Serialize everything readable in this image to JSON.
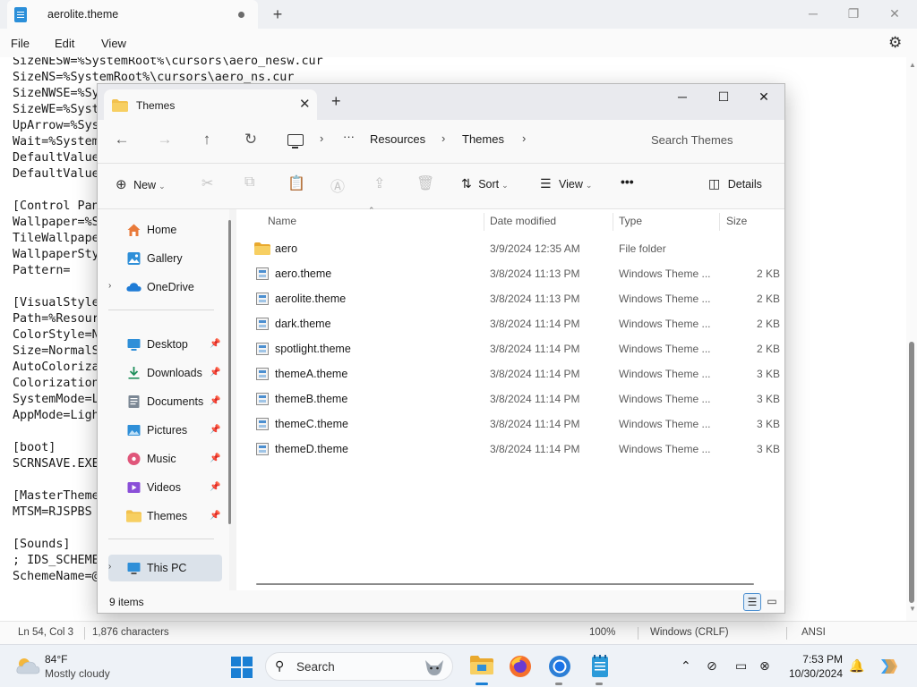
{
  "notepad": {
    "tab_title": "aerolite.theme",
    "menu": [
      "File",
      "Edit",
      "View"
    ],
    "lines": [
      "SizeNESW=%SystemRoot%\\cursors\\aero_nesw.cur",
      "SizeNS=%SystemRoot%\\cursors\\aero_ns.cur",
      "SizeNWSE=%Sy",
      "SizeWE=%Syst",
      "UpArrow=%Sys",
      "Wait=%System",
      "DefaultValue",
      "DefaultValue",
      "",
      "[Control Pan",
      "Wallpaper=%S",
      "TileWallpape",
      "WallpaperSty",
      "Pattern=",
      "",
      "[VisualStyle",
      "Path=%Resour",
      "ColorStyle=N",
      "Size=NormalS",
      "AutoColoriza",
      "Colorization",
      "SystemMode=L",
      "AppMode=Ligh",
      "",
      "[boot]",
      "SCRNSAVE.EXE",
      "",
      "[MasterTheme",
      "MTSM=RJSPBS",
      "",
      "[Sounds]",
      "; IDS_SCHEME",
      "SchemeName=@"
    ],
    "status": {
      "position": "Ln 54, Col 3",
      "characters": "1,876 characters",
      "zoom": "100%",
      "line_endings": "Windows (CRLF)",
      "encoding": "ANSI"
    }
  },
  "explorer": {
    "tab_title": "Themes",
    "breadcrumb": [
      "Resources",
      "Themes"
    ],
    "search_placeholder": "Search Themes",
    "toolbar": {
      "new": "New",
      "sort": "Sort",
      "view": "View",
      "more": "•••",
      "details": "Details"
    },
    "nav": {
      "home": "Home",
      "gallery": "Gallery",
      "onedrive": "OneDrive",
      "desktop": "Desktop",
      "downloads": "Downloads",
      "documents": "Documents",
      "pictures": "Pictures",
      "music": "Music",
      "videos": "Videos",
      "themes": "Themes",
      "thispc": "This PC"
    },
    "columns": [
      "Name",
      "Date modified",
      "Type",
      "Size"
    ],
    "files": [
      {
        "name": "aero",
        "date": "3/9/2024 12:35 AM",
        "type": "File folder",
        "size": "",
        "is_folder": true
      },
      {
        "name": "aero.theme",
        "date": "3/8/2024 11:13 PM",
        "type": "Windows Theme ...",
        "size": "2 KB"
      },
      {
        "name": "aerolite.theme",
        "date": "3/8/2024 11:13 PM",
        "type": "Windows Theme ...",
        "size": "2 KB"
      },
      {
        "name": "dark.theme",
        "date": "3/8/2024 11:14 PM",
        "type": "Windows Theme ...",
        "size": "2 KB"
      },
      {
        "name": "spotlight.theme",
        "date": "3/8/2024 11:14 PM",
        "type": "Windows Theme ...",
        "size": "2 KB"
      },
      {
        "name": "themeA.theme",
        "date": "3/8/2024 11:14 PM",
        "type": "Windows Theme ...",
        "size": "3 KB"
      },
      {
        "name": "themeB.theme",
        "date": "3/8/2024 11:14 PM",
        "type": "Windows Theme ...",
        "size": "3 KB"
      },
      {
        "name": "themeC.theme",
        "date": "3/8/2024 11:14 PM",
        "type": "Windows Theme ...",
        "size": "3 KB"
      },
      {
        "name": "themeD.theme",
        "date": "3/8/2024 11:14 PM",
        "type": "Windows Theme ...",
        "size": "3 KB"
      }
    ],
    "item_count": "9 items"
  },
  "taskbar": {
    "weather_temp": "84°F",
    "weather_desc": "Mostly cloudy",
    "search_label": "Search",
    "time": "7:53 PM",
    "date": "10/30/2024"
  },
  "colors": {
    "accent": "#1a7fd4",
    "folder": "#f2c14e"
  }
}
